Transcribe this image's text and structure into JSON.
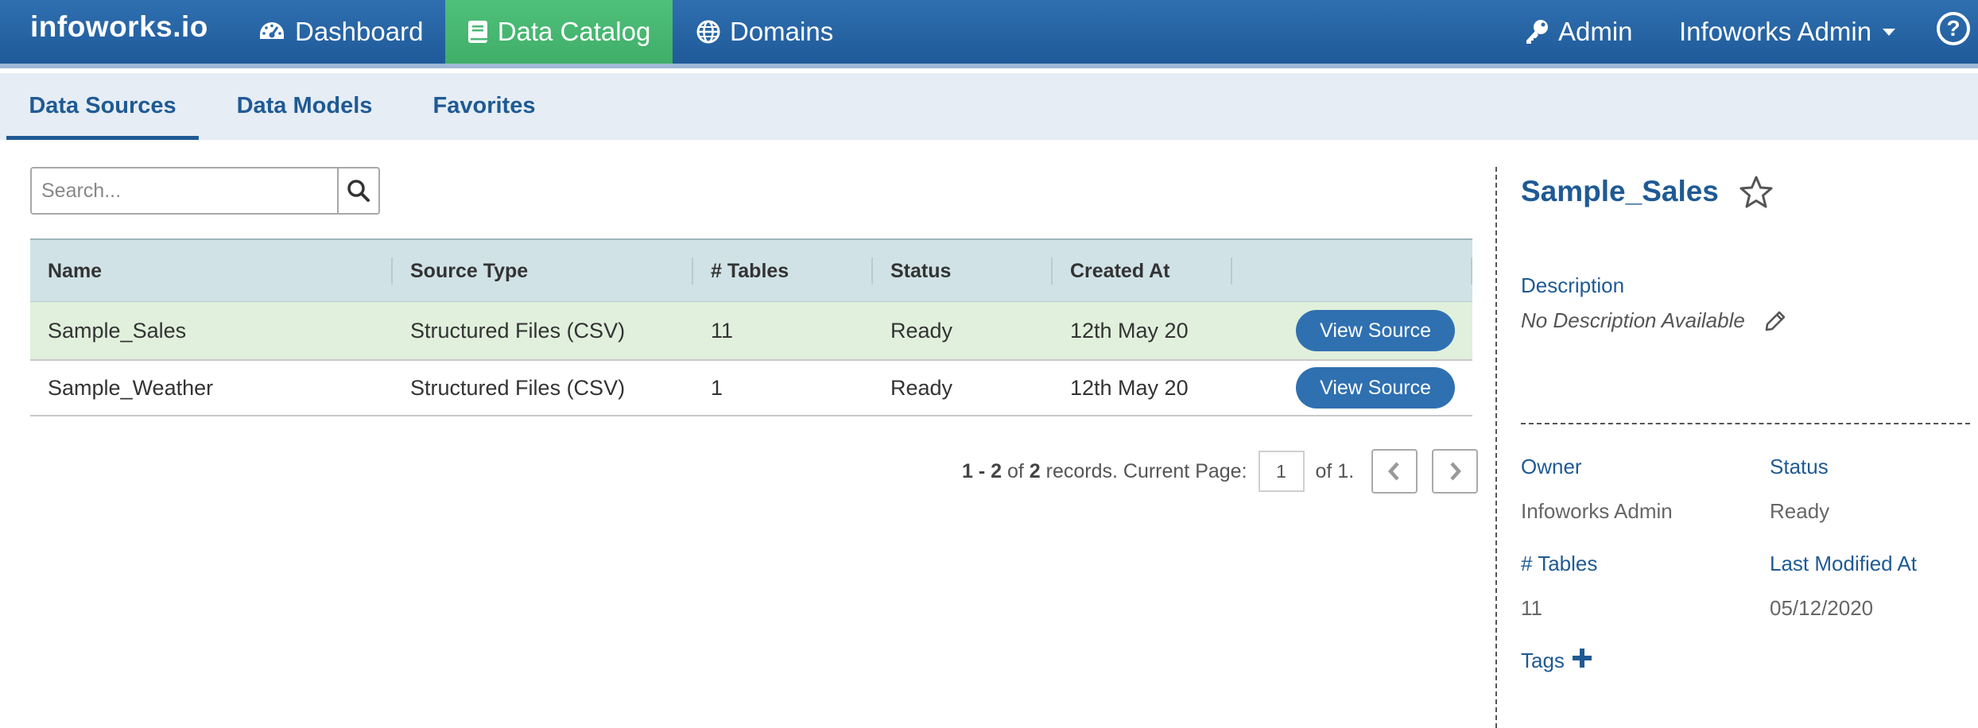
{
  "navbar": {
    "brand": "infoworks.io",
    "items": [
      {
        "label": "Dashboard",
        "icon": "speedometer-icon"
      },
      {
        "label": "Data Catalog",
        "icon": "book-icon",
        "active": true
      },
      {
        "label": "Domains",
        "icon": "globe-icon"
      }
    ],
    "admin_label": "Admin",
    "admin_icon": "key-icon",
    "user_label": "Infoworks Admin",
    "help_icon": "question-circle-icon",
    "help_glyph": "?"
  },
  "subnav": {
    "tabs": [
      {
        "label": "Data Sources",
        "active": true
      },
      {
        "label": "Data Models"
      },
      {
        "label": "Favorites"
      }
    ]
  },
  "search": {
    "placeholder": "Search...",
    "value": ""
  },
  "table": {
    "columns": [
      "Name",
      "Source Type",
      "# Tables",
      "Status",
      "Created At",
      ""
    ],
    "rows": [
      {
        "name": "Sample_Sales",
        "source_type": "Structured Files (CSV)",
        "tables": "11",
        "status": "Ready",
        "created_at": "12th May 20",
        "action": "View Source",
        "selected": true
      },
      {
        "name": "Sample_Weather",
        "source_type": "Structured Files (CSV)",
        "tables": "1",
        "status": "Ready",
        "created_at": "12th May 20",
        "action": "View Source",
        "selected": false
      }
    ]
  },
  "pagination": {
    "range": "1 - 2",
    "of_text": " of ",
    "total": "2",
    "suffix": " records. Current Page:",
    "current_page": "1",
    "page_total_text": "of 1."
  },
  "details": {
    "title": "Sample_Sales",
    "description_label": "Description",
    "description_value": "No Description Available",
    "owner_label": "Owner",
    "owner_value": "Infoworks Admin",
    "status_label": "Status",
    "status_value": "Ready",
    "tables_label": "# Tables",
    "tables_value": "11",
    "modified_label": "Last Modified At",
    "modified_value": "05/12/2020",
    "tags_label": "Tags"
  },
  "colors": {
    "nav_blue": "#2a68a8",
    "active_green": "#49b873",
    "link_blue": "#1f5a94",
    "button_blue": "#2f70b1",
    "selected_row": "#e0f0dc",
    "table_header": "#d0e2e6"
  }
}
